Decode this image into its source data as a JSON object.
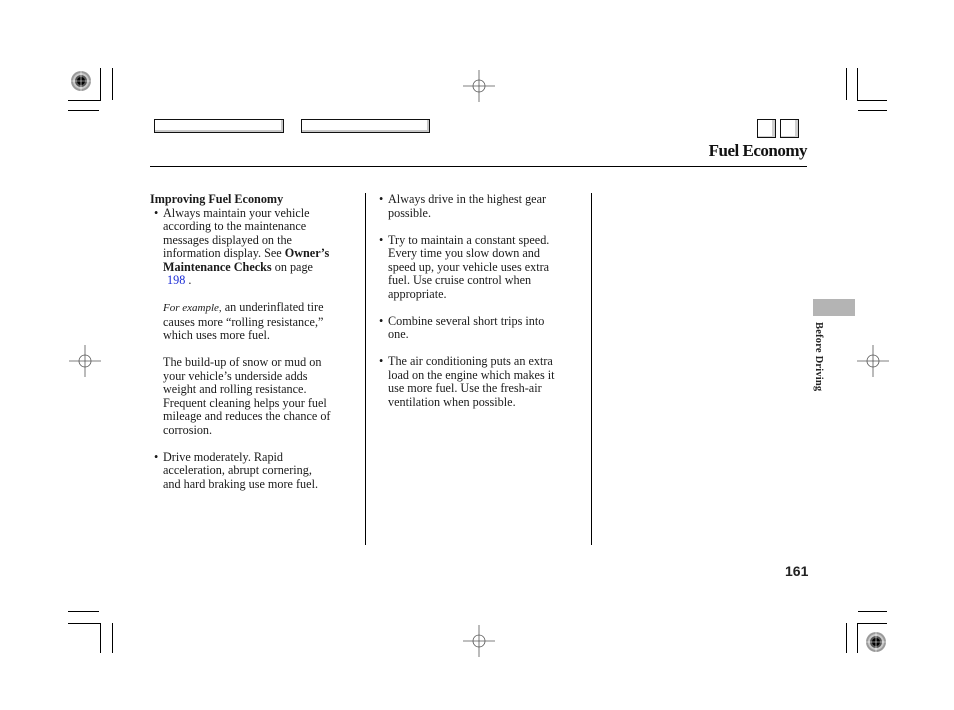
{
  "header": {
    "title": "Fuel Economy",
    "nav_buttons": [
      "",
      ""
    ],
    "square_buttons": [
      "",
      ""
    ]
  },
  "column1": {
    "heading": "Improving Fuel Economy",
    "bullet1": {
      "lines": [
        "Always maintain your vehicle",
        "according to the maintenance",
        "messages displayed on the",
        "information display. See "
      ],
      "bold_ref": "Owner’s",
      "bold_ref_line2": "Maintenance Checks",
      "after_ref": " on page",
      "page_link": "198",
      "page_link_suffix": " ."
    },
    "example": {
      "italic_lead": "For example,",
      "text_line1": " an underinflated tire",
      "lines": [
        "causes more “rolling resistance,”",
        "which uses more fuel."
      ]
    },
    "paragraph": [
      "The build-up of snow or mud on",
      "your vehicle’s underside adds",
      "weight and rolling resistance.",
      "Frequent cleaning helps your fuel",
      "mileage and reduces the chance of",
      "corrosion."
    ],
    "bullet2": [
      "Drive moderately. Rapid",
      "acceleration, abrupt cornering,",
      "and hard braking use more fuel."
    ]
  },
  "column2": {
    "bullets": [
      [
        "Always drive in the highest gear",
        "possible."
      ],
      [
        "Try to maintain a constant speed.",
        "Every time you slow down and",
        "speed up, your vehicle uses extra",
        "fuel. Use cruise control when",
        "appropriate."
      ],
      [
        "Combine several short trips into",
        "one."
      ],
      [
        "The air conditioning puts an extra",
        "load on the engine which makes it",
        "use more fuel. Use the fresh-air",
        "ventilation when possible."
      ]
    ]
  },
  "side_tab": {
    "label": "Before Driving",
    "color": "#b4b4b4"
  },
  "page_number": "161",
  "icons": {
    "registration_mark": "registration-target-icon",
    "crosshair": "crosshair-icon",
    "crop_mark": "crop-mark-icon"
  },
  "colors": {
    "link": "#1a2bd6",
    "text": "#1a1a1a"
  }
}
